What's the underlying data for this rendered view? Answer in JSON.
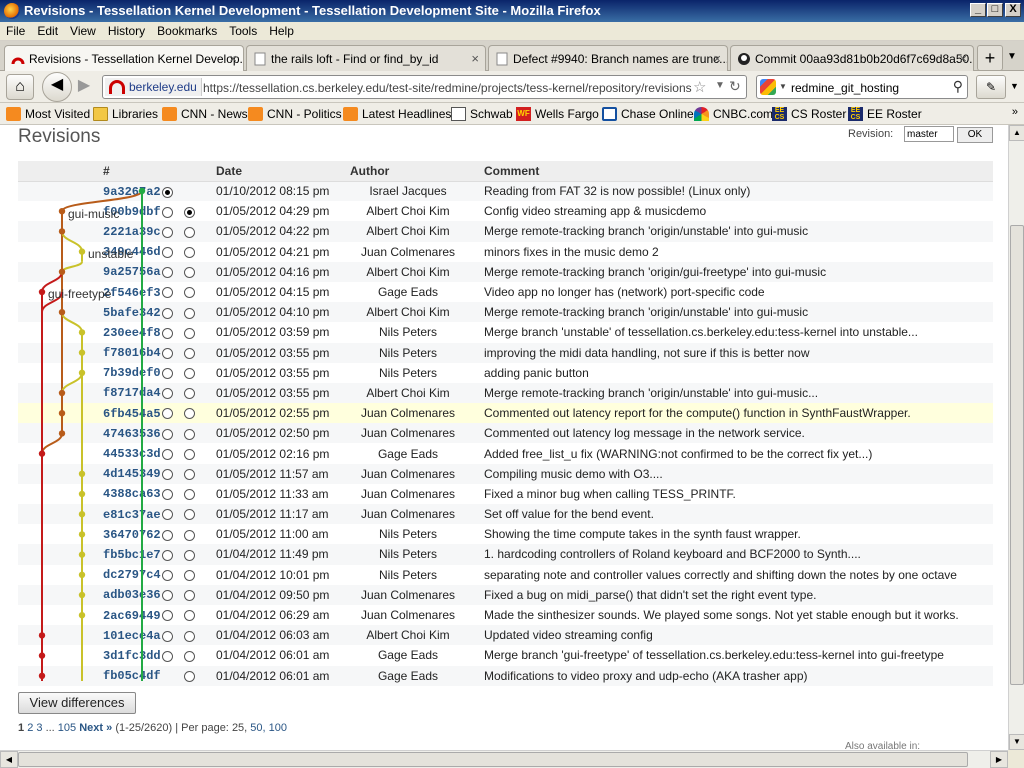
{
  "window": {
    "title": "Revisions - Tessellation Kernel Development - Tessellation Development Site - Mozilla Firefox",
    "buttons": [
      "_",
      "□",
      "X"
    ]
  },
  "menu": [
    "File",
    "Edit",
    "View",
    "History",
    "Bookmarks",
    "Tools",
    "Help"
  ],
  "tabs": [
    {
      "label": "Revisions - Tessellation Kernel Develop...",
      "active": true,
      "close": "×"
    },
    {
      "label": "the rails loft - Find or find_by_id",
      "active": false,
      "close": "×"
    },
    {
      "label": "Defect #9940: Branch names are trunc...",
      "active": false,
      "close": "×"
    },
    {
      "label": "Commit 00aa93d81b0b20d6f7c69d8a50...",
      "active": false,
      "close": "×"
    }
  ],
  "newtab_label": "+",
  "nav": {
    "site_label": "berkeley.edu",
    "url": "https://tessellation.cs.berkeley.edu/test-site/redmine/projects/tess-kernel/repository/revisions",
    "search_value": "redmine_git_hosting"
  },
  "bookmarks": [
    {
      "label": "Most Visited",
      "icon": "rss"
    },
    {
      "label": "Libraries",
      "icon": "folder"
    },
    {
      "label": "CNN - News",
      "icon": "rss"
    },
    {
      "label": "CNN - Politics",
      "icon": "rss"
    },
    {
      "label": "Latest Headlines",
      "icon": "rss"
    },
    {
      "label": "Schwab",
      "icon": "schwab"
    },
    {
      "label": "Wells Fargo",
      "icon": "wf"
    },
    {
      "label": "Chase Online",
      "icon": "chase"
    },
    {
      "label": "CNBC.com",
      "icon": "nbc"
    },
    {
      "label": "CS Roster",
      "icon": "eecs"
    },
    {
      "label": "EE Roster",
      "icon": "eecs"
    }
  ],
  "page": {
    "title": "Revisions",
    "revision_label": "Revision:",
    "revision_value": "master",
    "ok_label": "OK",
    "columns": {
      "id": "#",
      "date": "Date",
      "author": "Author",
      "comment": "Comment"
    },
    "branch_labels": [
      "gui-music",
      "unstable",
      "gui-freetype"
    ],
    "revisions": [
      {
        "id": "9a3267a2",
        "date": "01/10/2012 08:15 pm",
        "author": "Israel Jacques",
        "comment": "Reading from FAT 32 is now possible! (Linux only)"
      },
      {
        "id": "f00b9dbf",
        "date": "01/05/2012 04:29 pm",
        "author": "Albert Choi Kim",
        "comment": "Config video streaming app & musicdemo"
      },
      {
        "id": "2221a39c",
        "date": "01/05/2012 04:22 pm",
        "author": "Albert Choi Kim",
        "comment": "Merge remote-tracking branch 'origin/unstable' into gui-music"
      },
      {
        "id": "349c446d",
        "date": "01/05/2012 04:21 pm",
        "author": "Juan Colmenares",
        "comment": "minors fixes in the music demo 2"
      },
      {
        "id": "9a25756a",
        "date": "01/05/2012 04:16 pm",
        "author": "Albert Choi Kim",
        "comment": "Merge remote-tracking branch 'origin/gui-freetype' into gui-music"
      },
      {
        "id": "2f546ef3",
        "date": "01/05/2012 04:15 pm",
        "author": "Gage Eads",
        "comment": "Video app no longer has (network) port-specific code"
      },
      {
        "id": "5bafe342",
        "date": "01/05/2012 04:10 pm",
        "author": "Albert Choi Kim",
        "comment": "Merge remote-tracking branch 'origin/unstable' into gui-music"
      },
      {
        "id": "230ee4f8",
        "date": "01/05/2012 03:59 pm",
        "author": "Nils Peters",
        "comment": "Merge branch 'unstable' of tessellation.cs.berkeley.edu:tess-kernel into unstable..."
      },
      {
        "id": "f78016b4",
        "date": "01/05/2012 03:55 pm",
        "author": "Nils Peters",
        "comment": "improving the midi data handling, not sure if this is better now"
      },
      {
        "id": "7b39def0",
        "date": "01/05/2012 03:55 pm",
        "author": "Nils Peters",
        "comment": "adding panic button"
      },
      {
        "id": "f8717da4",
        "date": "01/05/2012 03:55 pm",
        "author": "Albert Choi Kim",
        "comment": "Merge remote-tracking branch 'origin/unstable' into gui-music..."
      },
      {
        "id": "6fb454a5",
        "date": "01/05/2012 02:55 pm",
        "author": "Juan Colmenares",
        "comment": "Commented out latency report for the compute() function in SynthFaustWrapper."
      },
      {
        "id": "47463536",
        "date": "01/05/2012 02:50 pm",
        "author": "Juan Colmenares",
        "comment": "Commented out latency log message in the network service."
      },
      {
        "id": "44533c3d",
        "date": "01/05/2012 02:16 pm",
        "author": "Gage Eads",
        "comment": "Added free_list_u fix (WARNING:not confirmed to be the correct fix yet...)"
      },
      {
        "id": "4d145349",
        "date": "01/05/2012 11:57 am",
        "author": "Juan Colmenares",
        "comment": "Compiling music demo with O3...."
      },
      {
        "id": "4388ca63",
        "date": "01/05/2012 11:33 am",
        "author": "Juan Colmenares",
        "comment": "Fixed a minor bug when calling TESS_PRINTF."
      },
      {
        "id": "e81c37ae",
        "date": "01/05/2012 11:17 am",
        "author": "Juan Colmenares",
        "comment": "Set off value for the bend event."
      },
      {
        "id": "36470762",
        "date": "01/05/2012 11:00 am",
        "author": "Nils Peters",
        "comment": "Showing the time compute takes in the synth faust wrapper."
      },
      {
        "id": "fb5bc1e7",
        "date": "01/04/2012 11:49 pm",
        "author": "Nils Peters",
        "comment": "1. hardcoding controllers of Roland keyboard and BCF2000 to Synth...."
      },
      {
        "id": "dc2797c4",
        "date": "01/04/2012 10:01 pm",
        "author": "Nils Peters",
        "comment": "separating note and controller values correctly and shifting down the notes by one octave"
      },
      {
        "id": "adb03e36",
        "date": "01/04/2012 09:50 pm",
        "author": "Juan Colmenares",
        "comment": "Fixed a bug on midi_parse() that didn't set the right event type."
      },
      {
        "id": "2ac69449",
        "date": "01/04/2012 06:29 am",
        "author": "Juan Colmenares",
        "comment": "Made the sinthesizer sounds. We played some songs. Not yet stable enough but it works."
      },
      {
        "id": "101ece4a",
        "date": "01/04/2012 06:03 am",
        "author": "Albert Choi Kim",
        "comment": "Updated video streaming config"
      },
      {
        "id": "3d1fc3dd",
        "date": "01/04/2012 06:01 am",
        "author": "Gage Eads",
        "comment": "Merge branch 'gui-freetype' of tessellation.cs.berkeley.edu:tess-kernel into gui-freetype"
      },
      {
        "id": "fb05c4df",
        "date": "01/04/2012 06:01 am",
        "author": "Gage Eads",
        "comment": "Modifications to video proxy and udp-echo (AKA trasher app)"
      }
    ],
    "highlighted_row": 11,
    "view_differences_label": "View differences",
    "pager": {
      "pages": [
        "1",
        "2",
        "3",
        "...",
        "105"
      ],
      "next": "Next »",
      "range": "(1-25/2620)",
      "per_page_label": "| Per page:",
      "per_page_current": "25,",
      "per_page_options": [
        "50,",
        "100"
      ]
    },
    "footnote": "Also available in:"
  },
  "colors": {
    "gui_music": "#b85c1a",
    "unstable": "#c9c22a",
    "gui_freetype": "#c41a1a",
    "master": "#22aa44",
    "link": "#2a5685"
  }
}
